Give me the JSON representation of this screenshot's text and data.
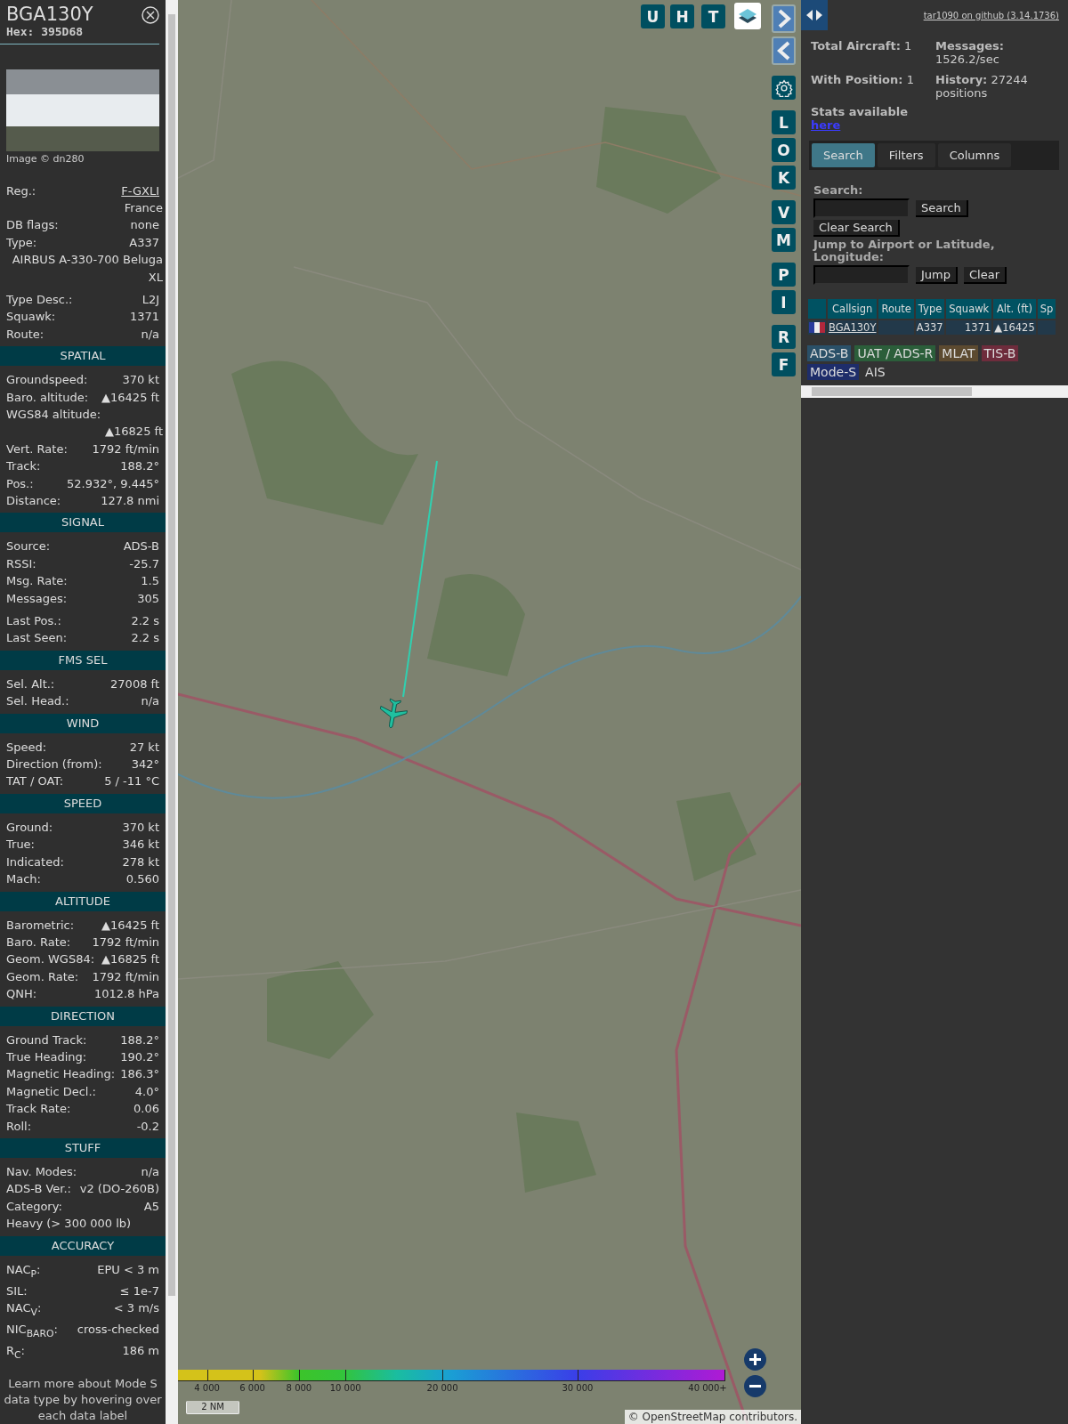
{
  "detail": {
    "callsign": "BGA130Y",
    "hex": "Hex: 395D68",
    "photo_credit": "Image © dn280",
    "sections": [
      {
        "groups": [
          [
            {
              "label": "Reg.:",
              "value": "F-GXLI",
              "kind": "link"
            },
            {
              "value": "France",
              "kind": "text"
            },
            {
              "label": "DB flags:",
              "value": "none",
              "kind": "text"
            },
            {
              "label": "Type:",
              "value": "A337",
              "kind": "text"
            },
            {
              "value": "AIRBUS A-330-700 Beluga XL",
              "kind": "text"
            }
          ],
          [
            {
              "label": "Type Desc.:",
              "value": "L2J",
              "kind": "text"
            },
            {
              "label": "Squawk:",
              "value": "1371",
              "kind": "text"
            },
            {
              "label": "Route:",
              "value": "n/a",
              "kind": "text"
            }
          ]
        ]
      },
      {
        "title": "SPATIAL",
        "groups": [
          [
            {
              "label": "Groundspeed:",
              "value": "370 kt"
            },
            {
              "label": "Baro. altitude:",
              "value": "▲16425 ft"
            },
            {
              "label": "WGS84 altitude:"
            },
            {
              "value": "▲16825 ft"
            },
            {
              "label": "Vert. Rate:",
              "value": "1792 ft/min"
            },
            {
              "label": "Track:",
              "value": "188.2°"
            },
            {
              "label": "Pos.:",
              "value": "52.932°, 9.445°"
            },
            {
              "label": "Distance:",
              "value": "127.8 nmi"
            }
          ]
        ]
      },
      {
        "title": "SIGNAL",
        "groups": [
          [
            {
              "label": "Source:",
              "value": "ADS-B"
            },
            {
              "label": "RSSI:",
              "value": "-25.7"
            },
            {
              "label": "Msg. Rate:",
              "value": "1.5"
            },
            {
              "label": "Messages:",
              "value": "305"
            }
          ],
          [
            {
              "label": "Last Pos.:",
              "value": "2.2 s"
            },
            {
              "label": "Last Seen:",
              "value": "2.2 s"
            }
          ]
        ]
      },
      {
        "title": "FMS SEL",
        "groups": [
          [
            {
              "label": "Sel. Alt.:",
              "value": "27008 ft"
            },
            {
              "label": "Sel. Head.:",
              "value": "n/a"
            }
          ]
        ]
      },
      {
        "title": "WIND",
        "groups": [
          [
            {
              "label": "Speed:",
              "value": "27 kt"
            },
            {
              "label": "Direction (from):",
              "value": "342°"
            },
            {
              "label": "TAT / OAT:",
              "value": "5 / -11 °C"
            }
          ]
        ]
      },
      {
        "title": "SPEED",
        "groups": [
          [
            {
              "label": "Ground:",
              "value": "370 kt"
            },
            {
              "label": "True:",
              "value": "346 kt"
            },
            {
              "label": "Indicated:",
              "value": "278 kt"
            },
            {
              "label": "Mach:",
              "value": "0.560"
            }
          ]
        ]
      },
      {
        "title": "ALTITUDE",
        "groups": [
          [
            {
              "label": "Barometric:",
              "value": "▲16425 ft"
            },
            {
              "label": "Baro. Rate:",
              "value": "1792 ft/min"
            },
            {
              "label": "Geom. WGS84:",
              "value": "▲16825 ft"
            },
            {
              "label": "Geom. Rate:",
              "value": "1792 ft/min"
            },
            {
              "label": "QNH:",
              "value": "1012.8 hPa"
            }
          ]
        ]
      },
      {
        "title": "DIRECTION",
        "groups": [
          [
            {
              "label": "Ground Track:",
              "value": "188.2°"
            },
            {
              "label": "True Heading:",
              "value": "190.2°"
            },
            {
              "label": "Magnetic Heading:",
              "value": "186.3°"
            },
            {
              "label": "Magnetic Decl.:",
              "value": "4.0°"
            },
            {
              "label": "Track Rate:",
              "value": "0.06"
            },
            {
              "label": "Roll:",
              "value": "-0.2"
            }
          ]
        ]
      },
      {
        "title": "STUFF",
        "groups": [
          [
            {
              "label": "Nav. Modes:",
              "value": "n/a"
            },
            {
              "label": "ADS-B Ver.:",
              "value": "v2 (DO-260B)"
            },
            {
              "label": "Category:",
              "value": "A5"
            },
            {
              "label": "Heavy (> 300 000 lb)"
            }
          ]
        ]
      },
      {
        "title": "ACCURACY",
        "groups": [
          [
            {
              "label": "NAC$_{P}$:",
              "value": "EPU < 3 m"
            },
            {
              "label": "SIL:",
              "value": "≤ 1e-7"
            },
            {
              "label": "NAC$_{V}$:",
              "value": "< 3 m/s"
            },
            {
              "label": "NIC$_{BARO}$:",
              "value": "cross-checked"
            },
            {
              "label": "R$_{C}$:",
              "value": "186 m"
            }
          ]
        ]
      }
    ],
    "footnote": "Learn more about Mode S data type by hovering over each data label"
  },
  "map": {
    "top_buttons": [
      {
        "kind": "letter",
        "label": "U"
      },
      {
        "kind": "letter",
        "label": "H"
      },
      {
        "kind": "letter",
        "label": "T"
      },
      {
        "kind": "layers"
      }
    ],
    "side_buttons": [
      [
        {
          "kind": "next"
        },
        {
          "kind": "prev"
        }
      ],
      [
        {
          "kind": "settings"
        }
      ],
      [
        {
          "kind": "letter",
          "label": "L"
        },
        {
          "kind": "letter",
          "label": "O"
        },
        {
          "kind": "letter",
          "label": "K"
        }
      ],
      [
        {
          "kind": "letter",
          "label": "V"
        },
        {
          "kind": "letter",
          "label": "M"
        }
      ],
      [
        {
          "kind": "letter",
          "label": "P"
        },
        {
          "kind": "letter",
          "label": "I"
        }
      ],
      [
        {
          "kind": "letter",
          "label": "R"
        },
        {
          "kind": "letter",
          "label": "F"
        }
      ]
    ],
    "altitude_legend": [
      "4 000",
      "6 000",
      "8 000",
      "10 000",
      "20 000",
      "30 000",
      "40 000+"
    ],
    "scale": "2 NM",
    "attribution": "© OpenStreetMap contributors."
  },
  "panel": {
    "github_link": "tar1090 on github (3.14.1736)",
    "stats": [
      {
        "label": "Total Aircraft:",
        "value": "1"
      },
      {
        "label": "Messages:",
        "value": "1526.2/sec"
      },
      {
        "label": "With Position:",
        "value": "1"
      },
      {
        "label": "History:",
        "value": "27244 positions"
      }
    ],
    "stats_note": "Stats available",
    "stats_link": "here",
    "tabs": [
      {
        "label": "Search",
        "selected": true
      },
      {
        "label": "Filters",
        "selected": false
      },
      {
        "label": "Columns",
        "selected": false
      }
    ],
    "search_label": "Search:",
    "search_button": "Search",
    "clear_search_button": "Clear Search",
    "jump_label": "Jump to Airport or Latitude, Longitude:",
    "jump_button": "Jump",
    "clear_button": "Clear",
    "table": {
      "columns": [
        "",
        "Callsign",
        "Route",
        "Type",
        "Squawk",
        "Alt. (ft)",
        "Sp"
      ],
      "rows": [
        {
          "callsign": "BGA130Y",
          "route": "",
          "type": "A337",
          "squawk": "1371",
          "altitude": "▲16425"
        }
      ]
    },
    "sources": [
      {
        "label": "ADS-B",
        "color": "#2a5068"
      },
      {
        "label": "UAT / ADS-R",
        "color": "#2b5e3a"
      },
      {
        "label": "MLAT",
        "color": "#5c4a30"
      },
      {
        "label": "TIS-B",
        "color": "#6e2c3c"
      },
      {
        "label": "Mode-S",
        "color": "#1e2d6a"
      },
      {
        "label": "AIS",
        "color": "#333333"
      }
    ]
  }
}
